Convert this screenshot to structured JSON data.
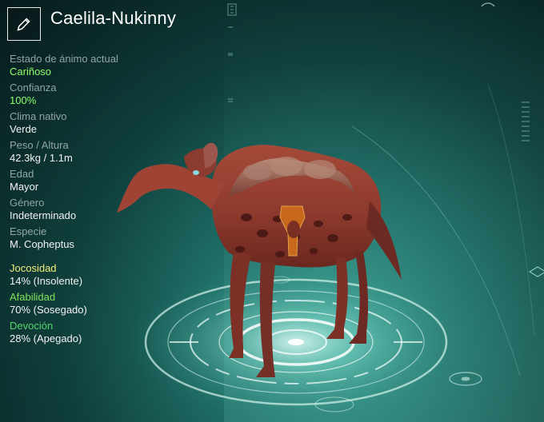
{
  "creature": {
    "name": "Caelila-Nukinny",
    "edit_icon": "pencil-icon"
  },
  "stats": [
    {
      "label": "Estado de ánimo actual",
      "value": "Cariñoso",
      "color": "#8dff6a"
    },
    {
      "label": "Confianza",
      "value": "100%",
      "color": "#8dff6a"
    },
    {
      "label": "Clima nativo",
      "value": "Verde",
      "color": "#f2f2f2"
    },
    {
      "label": "Peso / Altura",
      "value": "42.3kg / 1.1m",
      "color": "#f2f2f2"
    },
    {
      "label": "Edad",
      "value": "Mayor",
      "color": "#f2f2f2"
    },
    {
      "label": "Género",
      "value": "Indeterminado",
      "color": "#f2f2f2"
    },
    {
      "label": "Especie",
      "value": "M. Copheptus",
      "color": "#f2f2f2"
    }
  ],
  "traits": [
    {
      "label": "Jocosidad",
      "value": "14% (Insolente)",
      "color": "#f3ee7a"
    },
    {
      "label": "Afabilidad",
      "value": "70% (Sosegado)",
      "color": "#7fe35a"
    },
    {
      "label": "Devoción",
      "value": "28% (Apegado)",
      "color": "#54d66a"
    }
  ],
  "colors": {
    "background_core": "#3a9c8f",
    "background_edge": "#06191a",
    "platform_glow": "#d7f5ef",
    "creature_body": "#8e3a2e",
    "creature_pattern": "#4a1914",
    "saddle": "#c8681d"
  }
}
